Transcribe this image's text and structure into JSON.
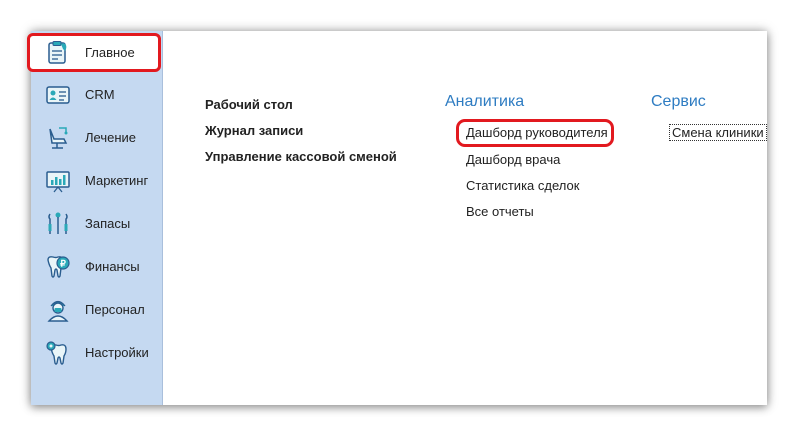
{
  "sidebar": {
    "items": [
      {
        "label": "Главное",
        "icon": "home-card-icon",
        "active": true
      },
      {
        "label": "CRM",
        "icon": "id-card-icon"
      },
      {
        "label": "Лечение",
        "icon": "dental-chair-icon"
      },
      {
        "label": "Маркетинг",
        "icon": "chart-board-icon"
      },
      {
        "label": "Запасы",
        "icon": "dental-tools-icon"
      },
      {
        "label": "Финансы",
        "icon": "tooth-coin-icon"
      },
      {
        "label": "Персонал",
        "icon": "doctor-icon"
      },
      {
        "label": "Настройки",
        "icon": "tooth-gear-icon"
      }
    ]
  },
  "main": {
    "links": [
      "Рабочий стол",
      "Журнал записи",
      "Управление кассовой сменой"
    ],
    "analytics": {
      "title": "Аналитика",
      "items": [
        "Дашборд руководителя",
        "Дашборд врача",
        "Статистика сделок",
        "Все отчеты"
      ]
    },
    "service": {
      "title": "Сервис",
      "items": [
        "Смена клиники"
      ]
    }
  },
  "colors": {
    "sidebar_bg": "#c5d9f1",
    "accent": "#2e7cc2",
    "highlight": "#e2191f",
    "icon_teal": "#2aa9b8"
  }
}
